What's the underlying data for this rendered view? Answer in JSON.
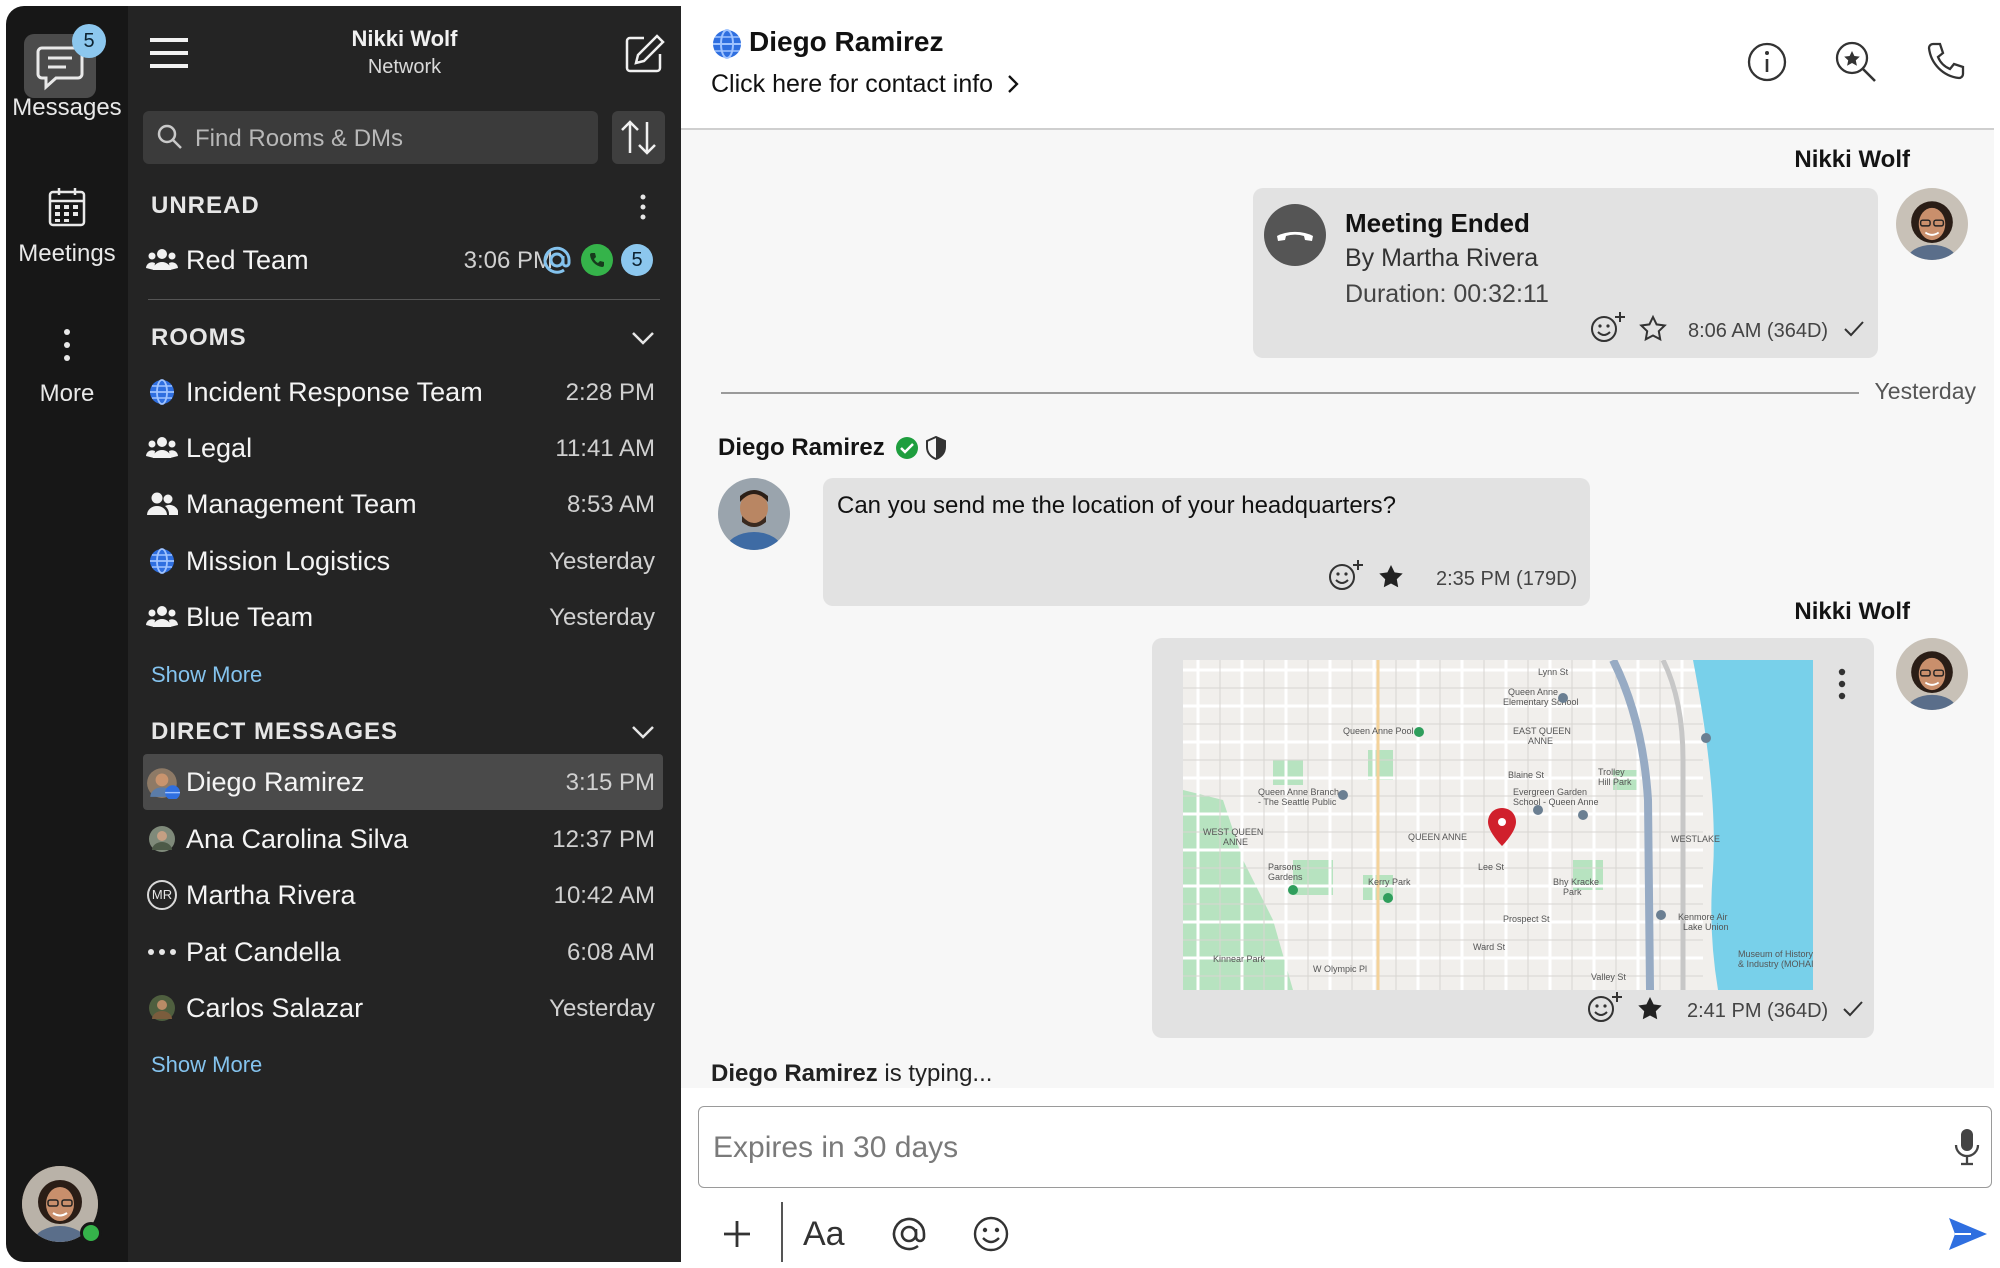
{
  "rail": {
    "messages_label": "Messages",
    "messages_badge": "5",
    "meetings_label": "Meetings",
    "more_label": "More"
  },
  "sidebar": {
    "user_name": "Nikki Wolf",
    "user_subtitle": "Network",
    "search_placeholder": "Find Rooms & DMs",
    "unread": {
      "header": "UNREAD",
      "items": [
        {
          "name": "Red Team",
          "time": "3:06 PM",
          "badge": "5"
        }
      ]
    },
    "rooms": {
      "header": "ROOMS",
      "items": [
        {
          "name": "Incident Response Team",
          "time": "2:28 PM",
          "icon": "globe-icon"
        },
        {
          "name": "Legal",
          "time": "11:41 AM",
          "icon": "group-icon"
        },
        {
          "name": "Management Team",
          "time": "8:53 AM",
          "icon": "pair-icon"
        },
        {
          "name": "Mission Logistics",
          "time": "Yesterday",
          "icon": "globe-icon"
        },
        {
          "name": "Blue Team",
          "time": "Yesterday",
          "icon": "group-icon"
        }
      ],
      "show_more": "Show More"
    },
    "direct_messages": {
      "header": "DIRECT MESSAGES",
      "items": [
        {
          "name": "Diego Ramirez",
          "time": "3:15 PM"
        },
        {
          "name": "Ana Carolina Silva",
          "time": "12:37 PM"
        },
        {
          "name": "Martha Rivera",
          "time": "10:42 AM",
          "initials": "MR"
        },
        {
          "name": "Pat Candella",
          "time": "6:08 AM"
        },
        {
          "name": "Carlos Salazar",
          "time": "Yesterday"
        }
      ],
      "show_more": "Show More"
    }
  },
  "header": {
    "contact_name": "Diego Ramirez",
    "contact_link": "Click here for contact info"
  },
  "messages": {
    "msg1": {
      "sender": "Nikki Wolf",
      "title": "Meeting Ended",
      "by": "By Martha Rivera",
      "duration": "Duration: 00:32:11",
      "time": "8:06 AM (364D)"
    },
    "date_separator": "Yesterday",
    "msg2": {
      "sender": "Diego Ramirez",
      "text": "Can you send me the location of your headquarters?",
      "time": "2:35 PM (179D)"
    },
    "msg3": {
      "sender": "Nikki Wolf",
      "time": "2:41 PM (364D)",
      "map_labels": [
        "EAST QUEEN ANNE",
        "Queen Anne Pool",
        "QUEEN ANNE",
        "WEST QUEEN ANNE",
        "Kerry Park",
        "Parsons Gardens",
        "WESTLAKE",
        "Trolley Hill Park",
        "Bhy Kracke Park",
        "Kinnear Park",
        "Queen Anne Elementary School",
        "Queen Anne Branch - The Seattle Public",
        "Evergreen Garden School - Queen Anne",
        "Museum of History & Industry (MOHAI)",
        "Kenmore Air Lake Union",
        "Valley St",
        "W Olympic Pl",
        "Prospect St",
        "Ward St",
        "Lee St",
        "Blaine St",
        "Lynn St"
      ]
    },
    "typing": {
      "name": "Diego Ramirez",
      "text": " is typing..."
    }
  },
  "composer": {
    "placeholder": "Expires in 30 days",
    "format_label": "Aa"
  },
  "colors": {
    "accent_blue": "#2f6fe0",
    "badge_blue": "#8cc7ee",
    "call_green": "#35b34a",
    "verified_green": "#1e9e3e",
    "pin_red": "#d0202c",
    "water": "#78d0ea"
  }
}
